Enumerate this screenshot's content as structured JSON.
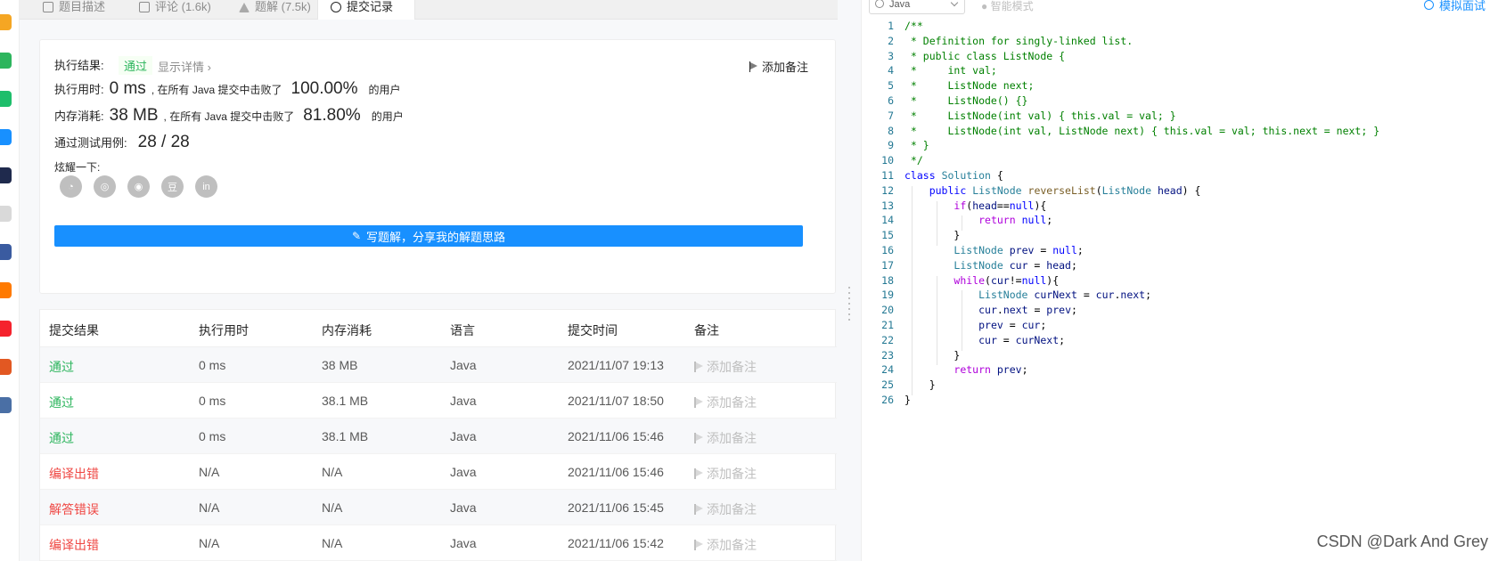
{
  "tabs": [
    {
      "label": "题目描述",
      "icon": "description-icon"
    },
    {
      "label": "评论 (1.6k)",
      "icon": "comment-icon"
    },
    {
      "label": "题解 (7.5k)",
      "icon": "solution-icon"
    },
    {
      "label": "提交记录",
      "icon": "history-icon"
    }
  ],
  "result": {
    "result_label": "执行结果:",
    "status": "通过",
    "detail_link": "显示详情 ›",
    "add_note": "添加备注",
    "time_label": "执行用时:",
    "time_value": "0 ms",
    "time_desc": ", 在所有 Java 提交中击败了",
    "time_pct": "100.00%",
    "time_suffix": "的用户",
    "mem_label": "内存消耗:",
    "mem_value": "38 MB",
    "mem_desc": ", 在所有 Java 提交中击败了",
    "mem_pct": "81.80%",
    "mem_suffix": "的用户",
    "cases_label": "通过测试用例:",
    "cases_value": "28 / 28",
    "share_label": "炫耀一下:",
    "share_icons": [
      "wechat-icon",
      "weibo-icon",
      "qq-icon",
      "douban-icon",
      "linkedin-icon"
    ],
    "share_glyphs": [
      "◔",
      "◎",
      "◉",
      "豆",
      "in"
    ],
    "write_button": "写题解，分享我的解题思路"
  },
  "table": {
    "headers": [
      "提交结果",
      "执行用时",
      "内存消耗",
      "语言",
      "提交时间",
      "备注"
    ],
    "rows": [
      {
        "result": "通过",
        "status": "ok",
        "time": "0 ms",
        "memory": "38 MB",
        "lang": "Java",
        "submitted": "2021/11/07 19:13",
        "note": "添加备注"
      },
      {
        "result": "通过",
        "status": "ok",
        "time": "0 ms",
        "memory": "38.1 MB",
        "lang": "Java",
        "submitted": "2021/11/07 18:50",
        "note": "添加备注"
      },
      {
        "result": "通过",
        "status": "ok",
        "time": "0 ms",
        "memory": "38.1 MB",
        "lang": "Java",
        "submitted": "2021/11/06 15:46",
        "note": "添加备注"
      },
      {
        "result": "编译出错",
        "status": "err",
        "time": "N/A",
        "memory": "N/A",
        "lang": "Java",
        "submitted": "2021/11/06 15:46",
        "note": "添加备注"
      },
      {
        "result": "解答错误",
        "status": "err",
        "time": "N/A",
        "memory": "N/A",
        "lang": "Java",
        "submitted": "2021/11/06 15:45",
        "note": "添加备注"
      },
      {
        "result": "编译出错",
        "status": "err",
        "time": "N/A",
        "memory": "N/A",
        "lang": "Java",
        "submitted": "2021/11/06 15:42",
        "note": "添加备注"
      }
    ]
  },
  "editor": {
    "language": "Java",
    "smart_mode": "智能模式",
    "mock_interview": "模拟面试",
    "lines": [
      {
        "n": "1",
        "t": [
          [
            "c-com",
            "/**"
          ]
        ]
      },
      {
        "n": "2",
        "t": [
          [
            "c-com",
            " * Definition for singly-linked list."
          ]
        ]
      },
      {
        "n": "3",
        "t": [
          [
            "c-com",
            " * public class ListNode {"
          ]
        ]
      },
      {
        "n": "4",
        "t": [
          [
            "c-com",
            " *     int val;"
          ]
        ]
      },
      {
        "n": "5",
        "t": [
          [
            "c-com",
            " *     ListNode next;"
          ]
        ]
      },
      {
        "n": "6",
        "t": [
          [
            "c-com",
            " *     ListNode() {}"
          ]
        ]
      },
      {
        "n": "7",
        "t": [
          [
            "c-com",
            " *     ListNode(int val) { this.val = val; }"
          ]
        ]
      },
      {
        "n": "8",
        "t": [
          [
            "c-com",
            " *     ListNode(int val, ListNode next) { this.val = val; this.next = next; }"
          ]
        ]
      },
      {
        "n": "9",
        "t": [
          [
            "c-com",
            " * }"
          ]
        ]
      },
      {
        "n": "10",
        "t": [
          [
            "c-com",
            " */"
          ]
        ]
      },
      {
        "n": "11",
        "t": [
          [
            "c-kw",
            "class"
          ],
          [
            "",
            " "
          ],
          [
            "c-ty",
            "Solution"
          ],
          [
            "",
            " {"
          ]
        ]
      },
      {
        "n": "12",
        "t": [
          [
            "",
            "    "
          ],
          [
            "c-kw",
            "public"
          ],
          [
            "",
            " "
          ],
          [
            "c-ty",
            "ListNode"
          ],
          [
            "",
            " "
          ],
          [
            "c-fn",
            "reverseList"
          ],
          [
            "",
            "("
          ],
          [
            "c-ty",
            "ListNode"
          ],
          [
            "",
            " "
          ],
          [
            "c-var",
            "head"
          ],
          [
            "",
            ") {"
          ]
        ]
      },
      {
        "n": "13",
        "t": [
          [
            "",
            "        "
          ],
          [
            "c-kw2",
            "if"
          ],
          [
            "",
            "("
          ],
          [
            "c-var",
            "head"
          ],
          [
            "",
            "=="
          ],
          [
            "c-kw",
            "null"
          ],
          [
            "",
            "){"
          ]
        ]
      },
      {
        "n": "14",
        "t": [
          [
            "",
            "            "
          ],
          [
            "c-kw2",
            "return"
          ],
          [
            "",
            " "
          ],
          [
            "c-kw",
            "null"
          ],
          [
            "",
            ";"
          ]
        ]
      },
      {
        "n": "15",
        "t": [
          [
            "",
            "        }"
          ]
        ]
      },
      {
        "n": "16",
        "t": [
          [
            "",
            "        "
          ],
          [
            "c-ty",
            "ListNode"
          ],
          [
            "",
            " "
          ],
          [
            "c-var",
            "prev"
          ],
          [
            "",
            " = "
          ],
          [
            "c-kw",
            "null"
          ],
          [
            "",
            ";"
          ]
        ]
      },
      {
        "n": "17",
        "t": [
          [
            "",
            "        "
          ],
          [
            "c-ty",
            "ListNode"
          ],
          [
            "",
            " "
          ],
          [
            "c-var",
            "cur"
          ],
          [
            "",
            " = "
          ],
          [
            "c-var",
            "head"
          ],
          [
            "",
            ";"
          ]
        ]
      },
      {
        "n": "18",
        "t": [
          [
            "",
            "        "
          ],
          [
            "c-kw2",
            "while"
          ],
          [
            "",
            "("
          ],
          [
            "c-var",
            "cur"
          ],
          [
            "",
            "!="
          ],
          [
            "c-kw",
            "null"
          ],
          [
            "",
            "){"
          ]
        ]
      },
      {
        "n": "19",
        "t": [
          [
            "",
            "            "
          ],
          [
            "c-ty",
            "ListNode"
          ],
          [
            "",
            " "
          ],
          [
            "c-var",
            "curNext"
          ],
          [
            "",
            " = "
          ],
          [
            "c-var",
            "cur"
          ],
          [
            "",
            "."
          ],
          [
            "c-var",
            "next"
          ],
          [
            "",
            ";"
          ]
        ]
      },
      {
        "n": "20",
        "t": [
          [
            "",
            "            "
          ],
          [
            "c-var",
            "cur"
          ],
          [
            "",
            "."
          ],
          [
            "c-var",
            "next"
          ],
          [
            "",
            " = "
          ],
          [
            "c-var",
            "prev"
          ],
          [
            "",
            ";"
          ]
        ]
      },
      {
        "n": "21",
        "t": [
          [
            "",
            "            "
          ],
          [
            "c-var",
            "prev"
          ],
          [
            "",
            " = "
          ],
          [
            "c-var",
            "cur"
          ],
          [
            "",
            ";"
          ]
        ]
      },
      {
        "n": "22",
        "t": [
          [
            "",
            "            "
          ],
          [
            "c-var",
            "cur"
          ],
          [
            "",
            " = "
          ],
          [
            "c-var",
            "curNext"
          ],
          [
            "",
            ";"
          ]
        ]
      },
      {
        "n": "23",
        "t": [
          [
            "",
            "        }"
          ]
        ]
      },
      {
        "n": "24",
        "t": [
          [
            "",
            "        "
          ],
          [
            "c-kw2",
            "return"
          ],
          [
            "",
            " "
          ],
          [
            "c-var",
            "prev"
          ],
          [
            "",
            ";"
          ]
        ]
      },
      {
        "n": "25",
        "t": [
          [
            "",
            "    }"
          ]
        ]
      },
      {
        "n": "26",
        "t": [
          [
            "",
            "}"
          ]
        ]
      }
    ]
  },
  "dock_icons": [
    {
      "name": "weibo-app-icon",
      "color": "#f5a623"
    },
    {
      "name": "mail-app-icon",
      "color": "#2db55d"
    },
    {
      "name": "wechat-app-icon",
      "color": "#1ebe6b"
    },
    {
      "name": "dingtalk-app-icon",
      "color": "#1890ff"
    },
    {
      "name": "news-app-icon",
      "color": "#1f2a4d"
    },
    {
      "name": "doc-app-icon",
      "color": "#d9d9d9"
    },
    {
      "name": "game-app-icon",
      "color": "#3a5ba0"
    },
    {
      "name": "taobao-app-icon",
      "color": "#ff7a00"
    },
    {
      "name": "shop-app-icon",
      "color": "#f5222d"
    },
    {
      "name": "store-app-icon",
      "color": "#e25822"
    },
    {
      "name": "photo-app-icon",
      "color": "#4a6fa5"
    }
  ],
  "watermark": "CSDN @Dark And Grey",
  "colors": {
    "accent": "#1890ff",
    "success": "#2db55d",
    "error": "#ef4743"
  }
}
